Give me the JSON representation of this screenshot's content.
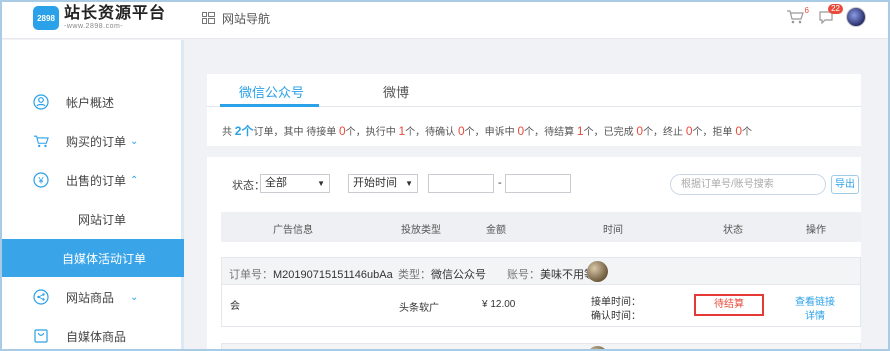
{
  "header": {
    "logo_badge": "2898",
    "logo_title": "站长资源平台",
    "logo_sub": "-www.2898.com-",
    "nav_label": "网站导航",
    "cart_count": "6",
    "message_count": "22"
  },
  "sidebar": {
    "items": [
      {
        "label": "帐户概述"
      },
      {
        "label": "购买的订单"
      },
      {
        "label": "出售的订单"
      },
      {
        "label": "网站订单"
      },
      {
        "label": "自媒体活动订单"
      },
      {
        "label": "网站商品"
      },
      {
        "label": "自媒体商品"
      }
    ]
  },
  "tabs": [
    {
      "label": "微信公众号"
    },
    {
      "label": "微博"
    }
  ],
  "summary": {
    "prefix": "共",
    "total": "2个",
    "unit": "订单，其中 待接单",
    "pending_accept": "0",
    "label_in_progress": "个，执行中",
    "in_progress": "1",
    "label_confirm": "个，待确认",
    "to_confirm": "0",
    "label_appeal": "个，申诉中",
    "appealing": "0",
    "label_settle": "个，待结算",
    "to_settle": "1",
    "label_done": "个，已完成",
    "completed": "0",
    "label_stopped": "个，终止",
    "stopped": "0",
    "label_rejected": "个，拒单",
    "rejected": "0",
    "suffix": "个"
  },
  "filters": {
    "status_label": "状态：",
    "status_value": "全部",
    "start_time": "开始时间",
    "dash": "-",
    "search_placeholder": "根据订单号/账号搜索",
    "export_label": "导出"
  },
  "table": {
    "headers": [
      "广告信息",
      "投放类型",
      "金额",
      "时间",
      "状态",
      "操作"
    ]
  },
  "order": {
    "order_no_label": "订单号：",
    "order_no": "M20190715151146ubAa",
    "type_label": "类型：",
    "type": "微信公众号",
    "account_label": "账号：",
    "account": "美味不用等",
    "ad_info": "会",
    "placement": "头条软广",
    "amount": "¥ 12.00",
    "accept_time_label": "接单时间：",
    "confirm_time_label": "确认时间：",
    "status": "待结算",
    "action_view": "查看链接",
    "action_detail": "详情"
  }
}
